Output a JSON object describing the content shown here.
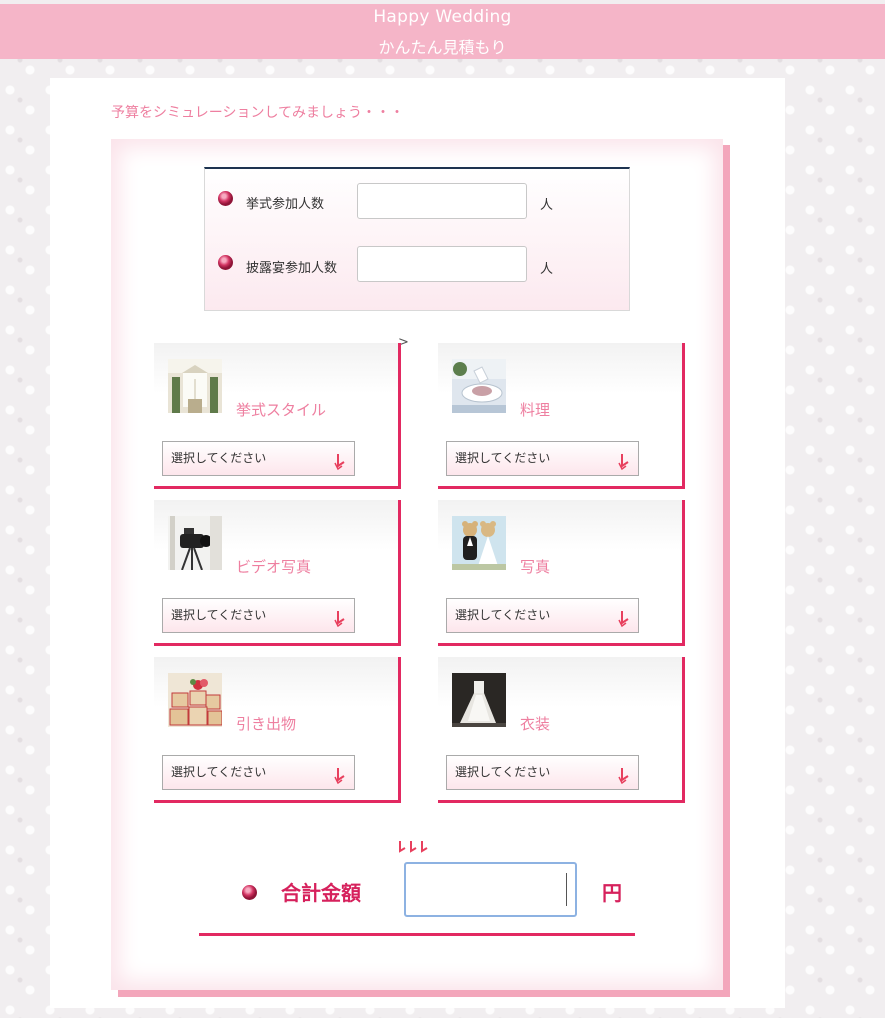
{
  "header": {
    "title_en": "Happy Wedding",
    "title_ja": "かんたん見積もり"
  },
  "intro_text": "予算をシミュレーションしてみましょう・・・",
  "guests": {
    "ceremony_label": "挙式参加人数",
    "ceremony_value": "",
    "ceremony_unit": "人",
    "reception_label": "披露宴参加人数",
    "reception_value": "",
    "reception_unit": "人"
  },
  "stray_mark": ">",
  "items": [
    {
      "title": "挙式スタイル",
      "select_value": "選択してください",
      "thumb_icon": "chapel-photo"
    },
    {
      "title": "料理",
      "select_value": "選択してください",
      "thumb_icon": "dish-photo"
    },
    {
      "title": "ビデオ写真",
      "select_value": "選択してください",
      "thumb_icon": "video-camera-photo"
    },
    {
      "title": "写真",
      "select_value": "選択してください",
      "thumb_icon": "teddy-bears-photo"
    },
    {
      "title": "引き出物",
      "select_value": "選択してください",
      "thumb_icon": "gift-boxes-photo"
    },
    {
      "title": "衣装",
      "select_value": "選択してください",
      "thumb_icon": "wedding-dress-photo"
    }
  ],
  "total": {
    "label": "合計金額",
    "value": "",
    "unit": "円"
  },
  "colors": {
    "header_bg": "#f5b5c8",
    "accent": "#e22961",
    "title_pink": "#ee7fa0",
    "total_text": "#d6215c"
  }
}
